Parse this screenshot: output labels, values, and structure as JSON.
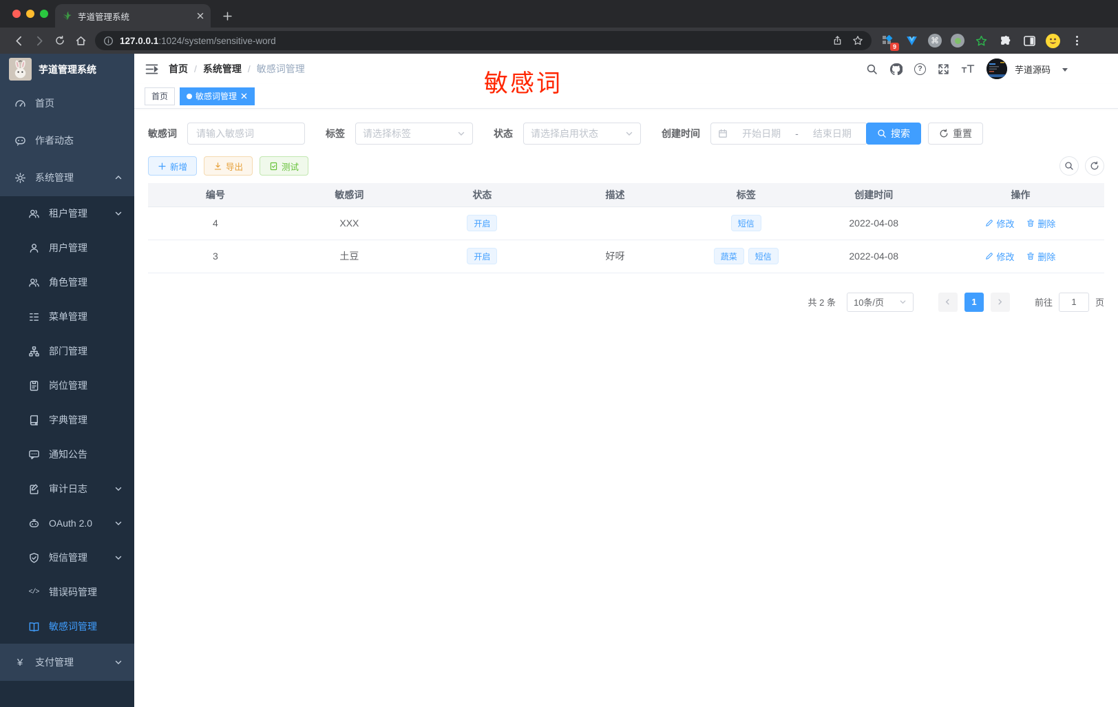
{
  "browser": {
    "tab_title": "芋道管理系统",
    "url_host": "127.0.0.1",
    "url_rest": ":1024/system/sensitive-word",
    "extension_badge": "9"
  },
  "sidebar": {
    "title": "芋道管理系统",
    "items": [
      {
        "label": "首页"
      },
      {
        "label": "作者动态"
      },
      {
        "label": "系统管理"
      },
      {
        "label": "租户管理"
      },
      {
        "label": "用户管理"
      },
      {
        "label": "角色管理"
      },
      {
        "label": "菜单管理"
      },
      {
        "label": "部门管理"
      },
      {
        "label": "岗位管理"
      },
      {
        "label": "字典管理"
      },
      {
        "label": "通知公告"
      },
      {
        "label": "审计日志"
      },
      {
        "label": "OAuth 2.0"
      },
      {
        "label": "短信管理"
      },
      {
        "label": "错误码管理"
      },
      {
        "label": "敏感词管理"
      },
      {
        "label": "支付管理"
      }
    ]
  },
  "header": {
    "breadcrumb": [
      "首页",
      "系统管理",
      "敏感词管理"
    ],
    "separator": "/",
    "annotation": "敏感词",
    "username": "芋道源码"
  },
  "tags_view": [
    {
      "label": "首页"
    },
    {
      "label": "敏感词管理"
    }
  ],
  "filter": {
    "keyword_label": "敏感词",
    "keyword_placeholder": "请输入敏感词",
    "tag_label": "标签",
    "tag_placeholder": "请选择标签",
    "status_label": "状态",
    "status_placeholder": "请选择启用状态",
    "date_label": "创建时间",
    "date_start": "开始日期",
    "date_separator": "-",
    "date_end": "结束日期",
    "search_label": "搜索",
    "reset_label": "重置"
  },
  "actions": {
    "add": "新增",
    "export": "导出",
    "test": "测试"
  },
  "table": {
    "headers": [
      "编号",
      "敏感词",
      "状态",
      "描述",
      "标签",
      "创建时间",
      "操作"
    ],
    "rows": [
      {
        "id": "4",
        "word": "XXX",
        "status": "开启",
        "desc": "",
        "tags": [
          "短信"
        ],
        "created": "2022-04-08"
      },
      {
        "id": "3",
        "word": "土豆",
        "status": "开启",
        "desc": "好呀",
        "tags": [
          "蔬菜",
          "短信"
        ],
        "created": "2022-04-08"
      }
    ],
    "edit_label": "修改",
    "delete_label": "删除"
  },
  "pagination": {
    "total": "共 2 条",
    "page_size": "10条/页",
    "current_page": "1",
    "goto_label": "前往",
    "goto_value": "1",
    "page_unit": "页"
  },
  "icons": {
    "yen": "¥",
    "code": "</>",
    "help": "?",
    "cmd": "⌘"
  },
  "colors": {
    "primary": "#409eff",
    "warning": "#e6a23c",
    "success": "#67c23a",
    "annotation_red": "#ff2600",
    "sidebar_bg": "#304156",
    "submenu_bg": "#1f2d3d"
  }
}
